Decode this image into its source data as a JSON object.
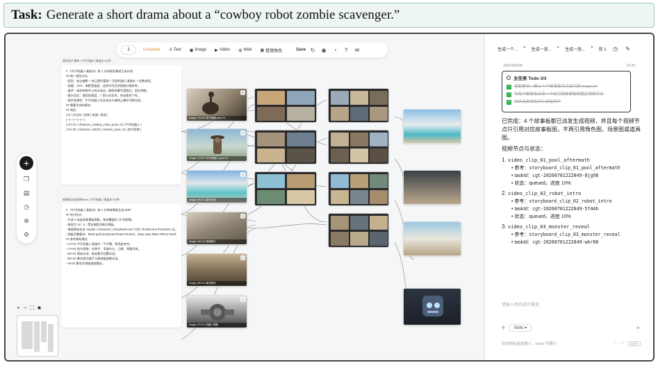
{
  "task": {
    "label": "Task:",
    "text": "Generate a short drama about a “cowboy robot zombie scavenger.”"
  },
  "toolbar": {
    "count": "3",
    "unsaved": "Unsaved",
    "text_label": "Text",
    "image_label": "Image",
    "video_label": "Video",
    "web_label": "Web",
    "manage_label": "管理角色",
    "save_label": "Save"
  },
  "colors": {
    "accent": "#2bb24c",
    "unsaved": "#e38a2c",
    "dark": "#1a1a1a"
  },
  "canvas": {
    "doc1": {
      "label": "冒险资产清单 | 牛仔机器人清道夫1分钟",
      "lines": [
        "# 《牛仔机器人清道夫》前 1 分钟视觉素材生成计划",
        "## 统一视觉方向",
        "- 类型：废土幽默 + 末日冒险喜剧 + 西部机器人清道夫 + 怪兽追逐。",
        "- 画幅：16:9，电影宽画面，适合作为后续视频分镜参考。",
        "- 美术：废弃购物中心的泳池边，破败的豪华度假村，阳光刺眼。",
        "- 镜头语言：使用低角度、广角与对比色，突出角色个性。",
        "- 角色关键性：牛仔机器人在泳池边沙滩椅上懒洋洋晒太阳。",
        "## 需要生成的素材",
        "## 角色",
        "| ID | 节点ID | 名称 | 来源 | 用途 |",
        "|---|---|---|---|---|",
        "| CH-01 | character_cowboy_robot_pose_01 | 牛仔机器人 |",
        "| CH-02 | character_ostrich_monster_pose_01 | 鸵鸟怪兽 |"
      ]
    },
    "doc2": {
      "label": "故事板生成说明Brief | 牛仔机器人清道夫1分钟",
      "lines": [
        "# 《牛仔机器人清道夫》前 1 分钟故事板生成 Brief",
        "## 交付形式",
        "- 生成 4 张连续故事板图板，每张覆盖约 15 秒剧情。",
        "- 每张为 16 : 9，黑金电影风格分镜板。",
        "- 每格图板包含 Header | Character | Storyboard 2x3 介绍 | Technical & Production 区。",
        "- 图板完整要求：black-gold storyboard board chrome，deep navy black #0510A background，dark gold #BC9572 module borders，dark gold title bars and dividers，black-gold Technical & Production panel。",
        "## 参考素材建议",
        "- CH-01 牛仔机器人清道夫：牛仔帽、牧场皮夹克。",
        "- CH-02 鸵鸟怪物：长脖子、弯曲鸟头、凸眼、骨骼羽毛。",
        "- BG-01 原始泳池：废弃豪华别墅泳池。",
        "- BG-02 豪宅室内客厅与落地窗面朝泳池。",
        "- 00-03 豪宅空调废墟前舞台。"
      ]
    },
    "images": [
      {
        "caption": "Image | CH-02 鸵鸟怪兽 pose 01",
        "badge": "1"
      },
      {
        "caption": "Image | CH-01 牛仔机器人 pose 01",
        "badge": "1"
      },
      {
        "caption": "Image | BG-01 豪华泳池",
        "badge": "1"
      },
      {
        "caption": "Image | BG-02 废墟客厅",
        "badge": "1"
      },
      {
        "caption": "Image | BG-03 豪宅室内",
        "badge": "1"
      },
      {
        "caption": "Image | PR-01 机器人残骸",
        "badge": "1"
      }
    ],
    "zoom_plus": "+",
    "zoom_minus": "−",
    "zoom_fit": "⛶"
  },
  "chat": {
    "tabs": [
      "生成一个...",
      "生成一我...",
      "生成一我...",
      "前 1"
    ],
    "agent_name": "JASVISHUB",
    "agent_time": "22:29",
    "todo_title": "主任务 Todo 3/3",
    "todo_items": [
      "读取素材，确认 4 个故事板节点及引用 imageUrl",
      "为每个故事板派发一个仅引用故事板的图生视频节点",
      "同步派发状态并汇总给用户"
    ],
    "intro": "已完成：4 个故事板都已派发生成视频，并且每个视频节点只引用对应故事板图，不再引用角色图、场景图或道具图。",
    "section_title": "视频节点与状态：",
    "clips": [
      {
        "num": "1.",
        "title": "video_clip_01_pool_aftermath",
        "ref_label": "参考：",
        "ref": "storyboard_clip_01_pool_aftermath",
        "task_label": "taskId：",
        "task": "cgt-20260701222849-8jg98",
        "status_label": "状态：",
        "status": "queued，进度 10%"
      },
      {
        "num": "2.",
        "title": "video_clip_02_robot_intro",
        "ref_label": "参考：",
        "ref": "storyboard_clip_02_robot_intro",
        "task_label": "taskId：",
        "task": "cgt-20260701222849-5f44h",
        "status_label": "状态：",
        "status": "queued，进度 10%"
      },
      {
        "num": "3.",
        "title": "video_clip_03_monster_reveal",
        "ref_label": "参考：",
        "ref": "storyboard_clip_03_monster_reveal",
        "task_label": "taskId：",
        "task": "cgt-20260701222849-wkr88",
        "status_label": "",
        "status": ""
      }
    ],
    "input_placeholder": "请输入你的设计需求",
    "skills_label": "Skills",
    "hint": "仅支持在此处输入，Enter 可换行",
    "chat_badge": "CHAT"
  }
}
